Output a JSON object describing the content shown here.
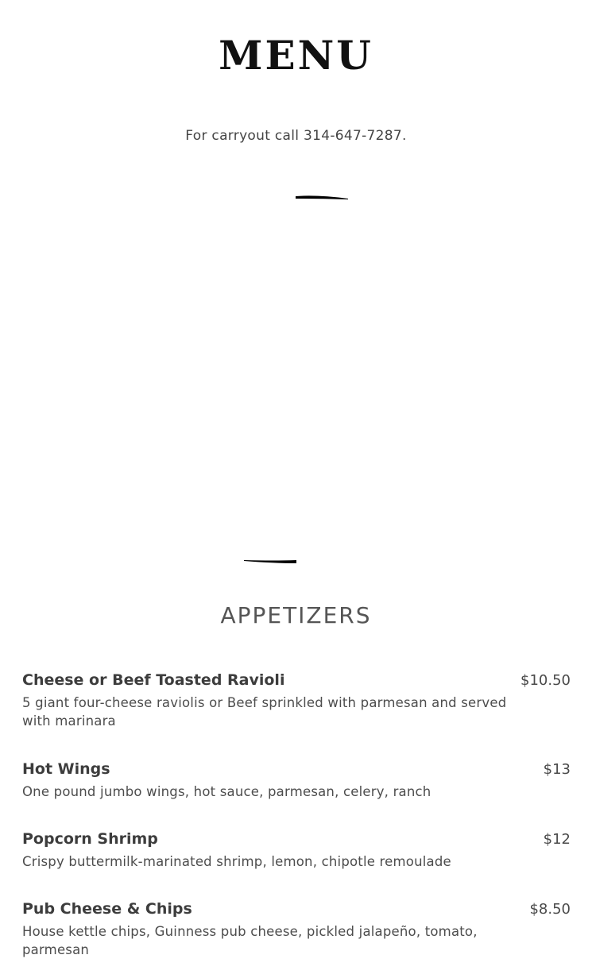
{
  "menu": {
    "title": "MENU",
    "carryout_text": "For carryout call 314-647-7287."
  },
  "section": {
    "title": "APPETIZERS",
    "items": [
      {
        "name": "Cheese or Beef Toasted Ravioli",
        "price": "$10.50",
        "description": "5 giant four-cheese raviolis or Beef sprinkled with parmesan and served with marinara"
      },
      {
        "name": "Hot Wings",
        "price": "$13",
        "description": "One pound jumbo wings, hot sauce, parmesan, celery, ranch"
      },
      {
        "name": "Popcorn Shrimp",
        "price": "$12",
        "description": "Crispy buttermilk-marinated shrimp, lemon, chipotle remoulade"
      },
      {
        "name": "Pub Cheese & Chips",
        "price": "$8.50",
        "description": "House kettle chips, Guinness pub cheese, pickled jalapeño, tomato, parmesan"
      }
    ]
  },
  "colors": {
    "text": "#3a3a3a",
    "title": "#111111",
    "background": "#ffffff"
  }
}
